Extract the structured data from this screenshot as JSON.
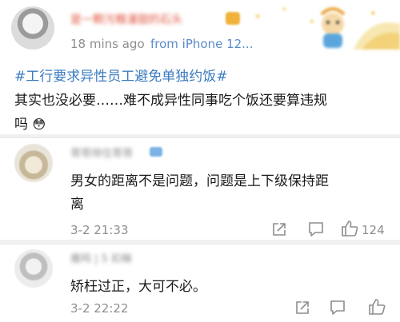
{
  "post": {
    "username": "是一颗污糗漫甜的石头",
    "time": "18 mins ago",
    "source": "from iPhone 12...",
    "hashtag": "#工行要求异性员工避免单独约饭#",
    "text_line1": "其实也没必要……难不成异性同事吃个饭还要算违规",
    "text_line2": "吗",
    "emoji": "😳"
  },
  "comments": [
    {
      "username": "哥哥排住哥哥",
      "text_line1": "男女的距离不是问题，问题是上下级保持距",
      "text_line2": "离",
      "date": "3-2 21:33",
      "like_count": "124"
    },
    {
      "username": "雁鸣 | 5 扣嘛",
      "text_line1": "矫枉过正，大可不必。",
      "date": "3-2 22:22"
    }
  ],
  "colors": {
    "hashtag": "#3b7bbf",
    "source": "#5b8bc9",
    "meta": "#8e8e8e",
    "username_blur": "#e0553e",
    "divider": "#e8e8e8"
  }
}
